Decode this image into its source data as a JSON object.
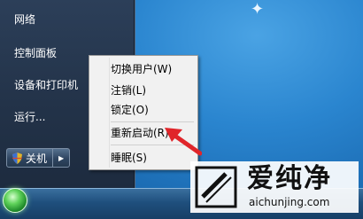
{
  "start_menu": {
    "items": [
      "网络",
      "控制面板",
      "设备和打印机",
      "运行..."
    ],
    "shutdown_label": "关机"
  },
  "context_menu": {
    "items": [
      "切换用户(W)",
      "注销(L)",
      "锁定(O)",
      "重新启动(R)",
      "睡眠(S)"
    ]
  },
  "watermark": {
    "title": "爱纯净",
    "url": "aichunjing.com"
  },
  "colors": {
    "arrow": "#e0252a",
    "start_menu_bg": "#233349",
    "context_menu_bg": "#f1f1f1"
  }
}
